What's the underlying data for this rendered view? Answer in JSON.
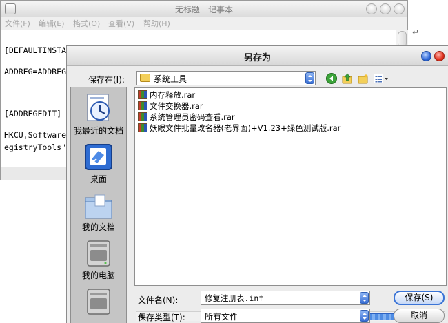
{
  "notepad": {
    "title": "无标题 - 记事本",
    "menu": [
      "文件(F)",
      "编辑(E)",
      "格式(O)",
      "查看(V)",
      "帮助(H)"
    ],
    "lines": [
      "[DEFAULTINSTALL]",
      "ADDREG=ADDREGEDIT",
      "[ADDREGEDIT]",
      "HKCU,Software\\Micros",
      "egistryTools\","
    ]
  },
  "dialog": {
    "title": "另存为",
    "save_in_label": "保存在(I):",
    "save_in_value": "系统工具",
    "toolbar_icons": [
      "back-icon",
      "up-folder-icon",
      "new-folder-icon",
      "view-menu-icon"
    ],
    "places": [
      {
        "label": "我最近的文档",
        "icon": "recent-documents-icon"
      },
      {
        "label": "桌面",
        "icon": "desktop-icon"
      },
      {
        "label": "我的文档",
        "icon": "my-documents-icon"
      },
      {
        "label": "我的电脑",
        "icon": "my-computer-icon"
      },
      {
        "label": "",
        "icon": "network-drive-icon"
      }
    ],
    "files": [
      "内存释放.rar",
      "文件交换器.rar",
      "系统管理员密码查看.rar",
      "妖眼文件批量改名器(老界面)+V1.23+绿色测试版.rar"
    ],
    "filename_label": "文件名(N):",
    "filename_value": "修复注册表.inf",
    "filetype_label": "保存类型(T):",
    "filetype_value": "所有文件",
    "save_button": "保存(S)",
    "cancel_button": "取消"
  },
  "colors": {
    "accent_blue": "#3b74d6",
    "close_red": "#e0321f",
    "folder_yellow": "#f3cf59"
  }
}
